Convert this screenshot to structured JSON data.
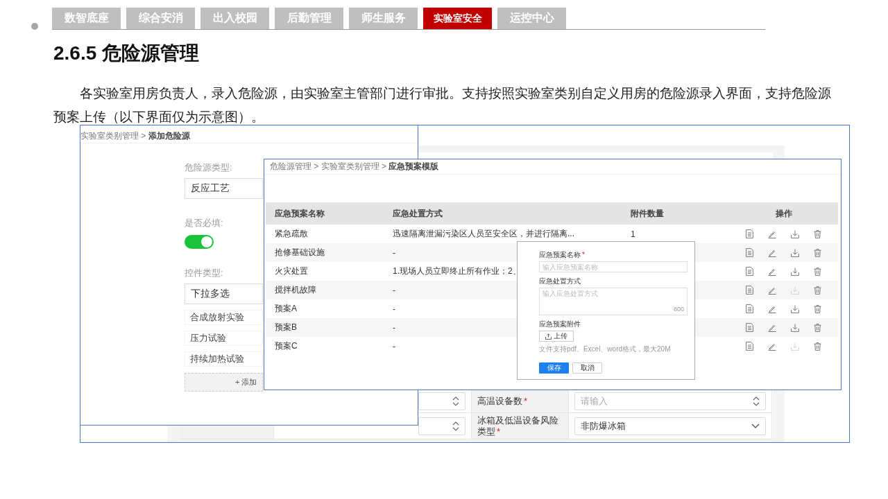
{
  "nav_tabs": [
    {
      "label": "数智底座",
      "selected": false
    },
    {
      "label": "综合安消",
      "selected": false
    },
    {
      "label": "出入校园",
      "selected": false
    },
    {
      "label": "后勤管理",
      "selected": false
    },
    {
      "label": "师生服务",
      "selected": false
    },
    {
      "label": "实验室安全",
      "selected": true
    },
    {
      "label": "运控中心",
      "selected": false
    }
  ],
  "heading": "2.6.5 危险源管理",
  "paragraph": "各实验室用房负责人，录入危险源，由实验室主管部门进行审批。支持按照实验室类别自定义用房的危险源录入界面，支持危险源预案上传（以下界面仅为示意图）。",
  "background_form": {
    "rows": [
      {
        "right_label": "高温设备数",
        "right_mark": "*",
        "right_placeholder": "请输入"
      },
      {
        "right_label": "冰箱及低温设备风险类型",
        "right_mark": "*",
        "right_value": "非防爆冰箱"
      }
    ]
  },
  "left_window": {
    "breadcrumb": "实验室类别管理 > **添加危险源**",
    "type_label": "危险源类型:",
    "type_value": "反应工艺",
    "required_label": "是否必填:",
    "required_on": true,
    "control_label": "控件类型:",
    "control_value": "下拉多选",
    "options": [
      "合成放射实验",
      "压力试验",
      "持续加热试验"
    ],
    "add_button": "+ 添加"
  },
  "table_window": {
    "breadcrumb": "危险源管理 > 实验室类别管理 > **应急预案模版**",
    "columns": [
      "应急预案名称",
      "应急处置方式",
      "附件数量",
      "操作"
    ],
    "rows": [
      {
        "name": "紧急疏散",
        "method": "迅速隔离泄漏污染区人员至安全区，并进行隔离...",
        "count": "1",
        "download_disabled": false
      },
      {
        "name": "抢修基础设施",
        "method": "-",
        "download_disabled": false
      },
      {
        "name": "火灾处置",
        "method": "1.现场人员立即终止所有作业；2、",
        "download_disabled": false
      },
      {
        "name": "搅拌机故障",
        "method": "-",
        "download_disabled": true
      },
      {
        "name": "预案A",
        "method": "-",
        "download_disabled": false
      },
      {
        "name": "预案B",
        "method": "-",
        "download_disabled": false
      },
      {
        "name": "预案C",
        "method": "-",
        "download_disabled": true
      }
    ]
  },
  "dialog": {
    "name_label": "应急预案名称",
    "name_mark": "*",
    "name_placeholder": "输入应急预案名称",
    "method_label": "应急处置方式",
    "method_placeholder": "输入应急处置方式",
    "method_counter": "800",
    "attach_label": "应急预案附件",
    "upload_button": "上传",
    "attach_hint": "文件支持pdf、Excel、word格式，最大20M",
    "save_button": "保存",
    "cancel_button": "取消"
  }
}
